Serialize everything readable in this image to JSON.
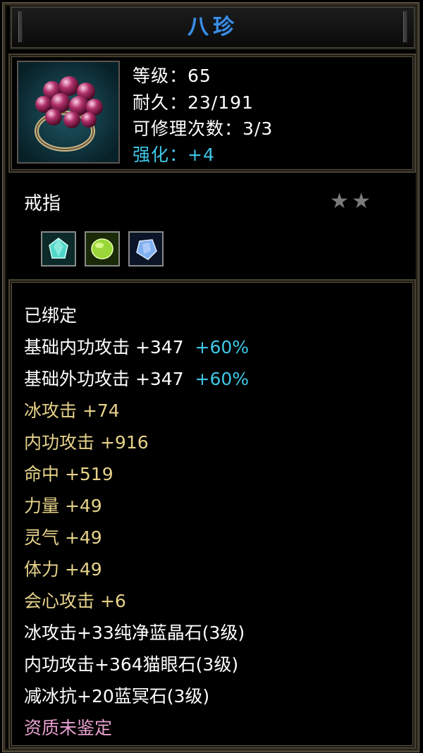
{
  "item": {
    "name": "八珍",
    "level_label": "等级：65",
    "durability_label": "耐久：23/191",
    "repair_label": "可修理次数：3/3",
    "enhance_label": "强化：+4",
    "type": "戒指",
    "stars": "★★"
  },
  "gems": [
    {
      "name": "cyan-gem-icon",
      "color": "#4fd6c8"
    },
    {
      "name": "green-gem-icon",
      "color": "#9ad63a"
    },
    {
      "name": "blue-gem-icon",
      "color": "#7fb0f0"
    }
  ],
  "attributes": {
    "bound": "已绑定",
    "base_inner": {
      "label": "基础内功攻击  +347",
      "bonus": "+60%"
    },
    "base_outer": {
      "label": "基础外功攻击  +347",
      "bonus": "+60%"
    },
    "ice_attack": "冰攻击  +74",
    "inner_attack": "内功攻击  +916",
    "hit": "命中  +519",
    "strength": "力量  +49",
    "spirit": "灵气  +49",
    "stamina": "体力  +49",
    "critical": "会心攻击  +6",
    "gem_line_1": "冰攻击+33纯净蓝晶石(3级)",
    "gem_line_2": "内功攻击+364猫眼石(3级)",
    "gem_line_3": "减冰抗+20蓝冥石(3级)",
    "quality": "资质未鉴定"
  },
  "colors": {
    "title": "#3c8fe6",
    "enhance": "#3ec8e6",
    "attribute": "#e6d28a",
    "quality": "#e8a0d0"
  }
}
